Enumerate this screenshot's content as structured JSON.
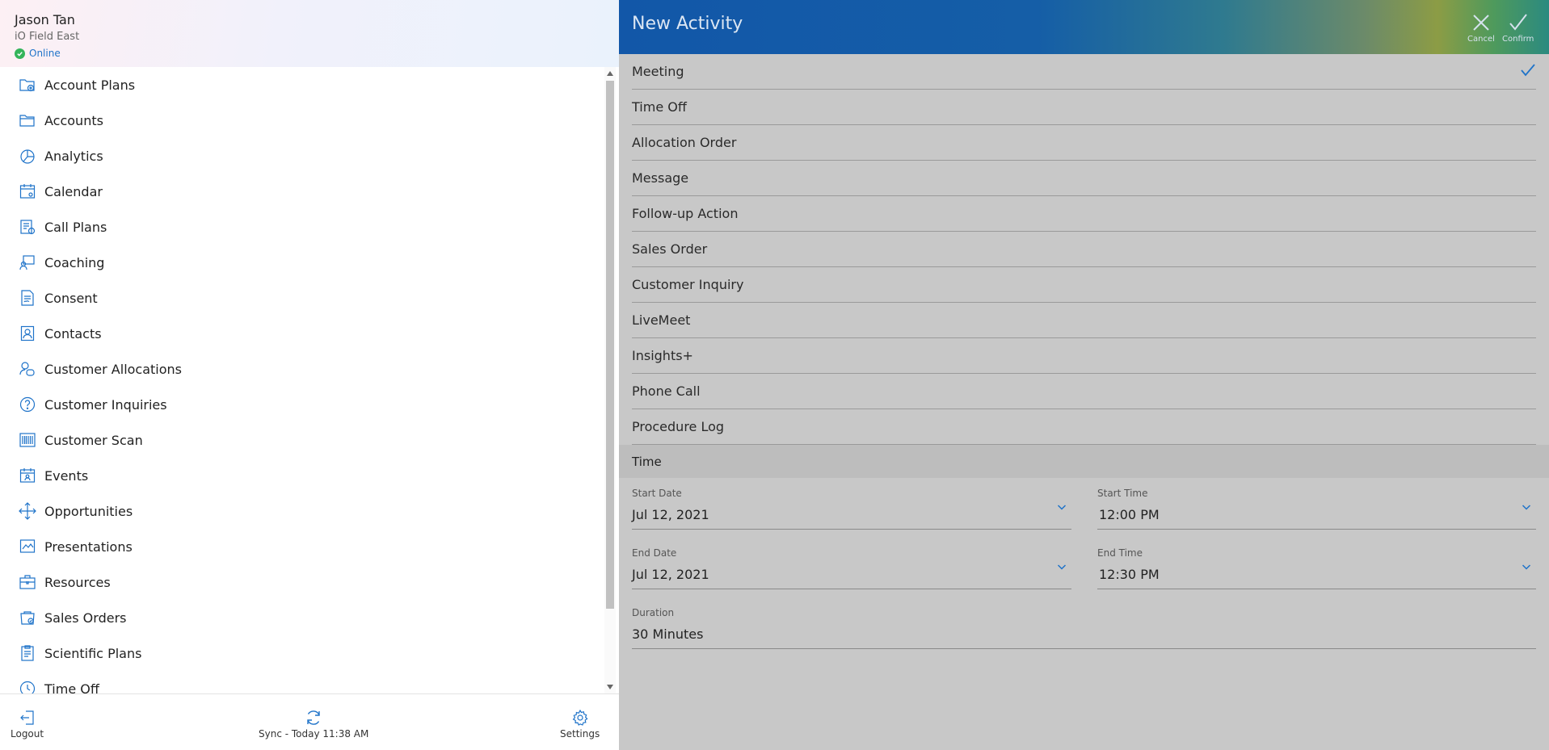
{
  "profile": {
    "user_name": "Jason Tan",
    "org": "iO Field East",
    "status": "Online"
  },
  "nav": {
    "items": [
      {
        "label": "Account Plans",
        "icon": "account-plans-icon"
      },
      {
        "label": "Accounts",
        "icon": "accounts-icon"
      },
      {
        "label": "Analytics",
        "icon": "analytics-icon"
      },
      {
        "label": "Calendar",
        "icon": "calendar-icon"
      },
      {
        "label": "Call Plans",
        "icon": "call-plans-icon"
      },
      {
        "label": "Coaching",
        "icon": "coaching-icon"
      },
      {
        "label": "Consent",
        "icon": "consent-icon"
      },
      {
        "label": "Contacts",
        "icon": "contacts-icon"
      },
      {
        "label": "Customer Allocations",
        "icon": "customer-allocations-icon"
      },
      {
        "label": "Customer Inquiries",
        "icon": "customer-inquiries-icon"
      },
      {
        "label": "Customer Scan",
        "icon": "barcode-icon"
      },
      {
        "label": "Events",
        "icon": "events-icon"
      },
      {
        "label": "Opportunities",
        "icon": "opportunities-icon"
      },
      {
        "label": "Presentations",
        "icon": "presentations-icon"
      },
      {
        "label": "Resources",
        "icon": "resources-icon"
      },
      {
        "label": "Sales Orders",
        "icon": "sales-orders-icon"
      },
      {
        "label": "Scientific Plans",
        "icon": "scientific-plans-icon"
      },
      {
        "label": "Time Off",
        "icon": "time-off-icon"
      }
    ]
  },
  "footer": {
    "logout": "Logout",
    "sync": "Sync - Today 11:38 AM",
    "settings": "Settings"
  },
  "activity": {
    "title": "New Activity",
    "cancel": "Cancel",
    "confirm": "Confirm",
    "types": [
      {
        "label": "Meeting",
        "selected": true
      },
      {
        "label": "Time Off",
        "selected": false
      },
      {
        "label": "Allocation Order",
        "selected": false
      },
      {
        "label": "Message",
        "selected": false
      },
      {
        "label": "Follow-up Action",
        "selected": false
      },
      {
        "label": "Sales Order",
        "selected": false
      },
      {
        "label": "Customer Inquiry",
        "selected": false
      },
      {
        "label": "LiveMeet",
        "selected": false
      },
      {
        "label": "Insights+",
        "selected": false
      },
      {
        "label": "Phone Call",
        "selected": false
      },
      {
        "label": "Procedure Log",
        "selected": false
      }
    ],
    "time_section": "Time",
    "start_date": {
      "label": "Start Date",
      "value": "Jul 12, 2021"
    },
    "start_time": {
      "label": "Start Time",
      "value": "12:00 PM"
    },
    "end_date": {
      "label": "End Date",
      "value": "Jul 12, 2021"
    },
    "end_time": {
      "label": "End Time",
      "value": "12:30 PM"
    },
    "duration": {
      "label": "Duration",
      "value": "30 Minutes"
    }
  },
  "colors": {
    "accent": "#1f73c9",
    "online": "#34b45a",
    "panel_bg": "#c8c8c8"
  }
}
